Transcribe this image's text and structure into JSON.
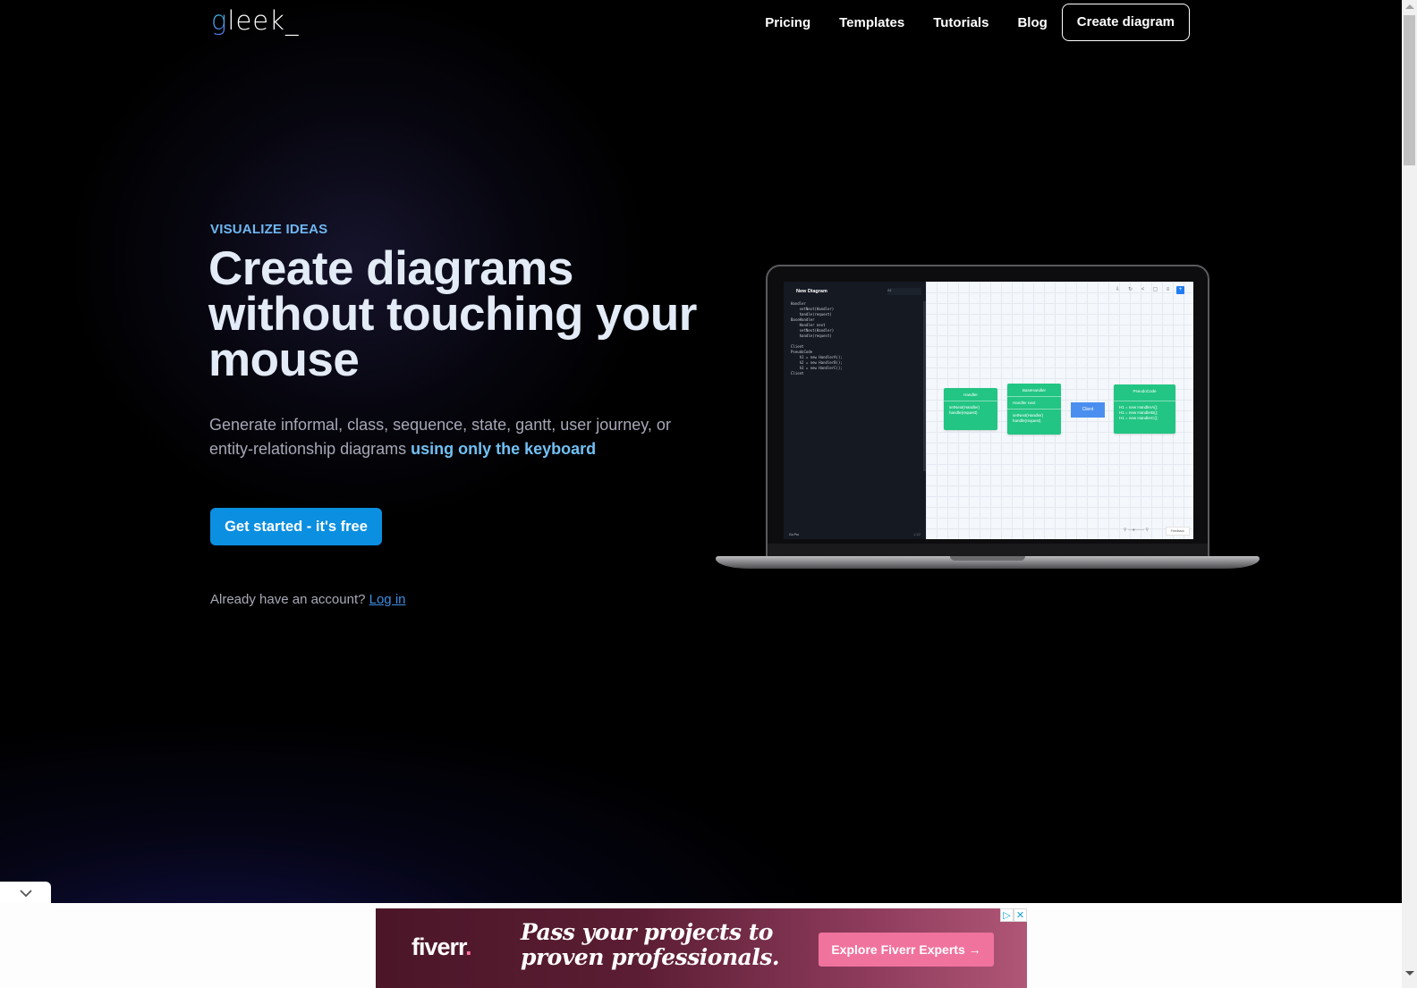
{
  "brand": {
    "logo_first": "g",
    "logo_rest": "leek_"
  },
  "nav": {
    "links": [
      "Pricing",
      "Templates",
      "Tutorials",
      "Blog"
    ],
    "cta": "Create diagram"
  },
  "hero": {
    "eyebrow": "VISUALIZE IDEAS",
    "headline": "Create diagrams without touching your mouse",
    "subtitle_plain": "Generate informal, class, sequence, state, gantt, user journey, or entity-relationship diagrams ",
    "subtitle_highlight": "using only the keyboard",
    "cta": "Get started - it's free",
    "account_prompt": "Already have an account?",
    "login": "Log in"
  },
  "mockup": {
    "editor_title": "New Diagram",
    "language_select": "All",
    "code": "Handler\n    setNext(Handler)\n    handle(request)\nBaseHandler\n    Handler next\n    setNext(Handler)\n    handle(request)\n\nClient\nPseudoCode\n    h1 = new HandlerA();\n    h2 = new HandlerB();\n    h3 = new HandlerC();\nClient",
    "footer_left": "Go Pro",
    "footer_right": "1:1/2",
    "nodes": [
      {
        "title": "Handler",
        "members": [],
        "methods": [
          "setNext(Handler)",
          "handle(request)"
        ]
      },
      {
        "title": "BaseHandler",
        "members": [
          "Handler next"
        ],
        "methods": [
          "setNext(Handler)",
          "handle(request)"
        ]
      },
      {
        "title": "PseudoCode",
        "members": [],
        "methods": [
          "H1 = new HandlerA();",
          "H1 = new HandlerB();",
          "H1 = new HandlerC();"
        ]
      }
    ],
    "client": "Client",
    "feedback": "Feedback",
    "toolbar_icons": [
      "download-icon",
      "refresh-icon",
      "share-icon",
      "fit-icon",
      "layout-icon",
      "plus-icon"
    ]
  },
  "ad": {
    "brand": "fiverr",
    "brand_dot": ".",
    "headline_line1": "Pass your projects to",
    "headline_line2": "proven professionals.",
    "cta": "Explore Fiverr Experts →",
    "adchoices": "▷",
    "close": "✕"
  },
  "colors": {
    "accent": "#0b8fe0",
    "eyebrow": "#6fb7f1",
    "node_green": "#22c583",
    "client_blue": "#4a8ff0",
    "ad_button": "#f0739d"
  }
}
